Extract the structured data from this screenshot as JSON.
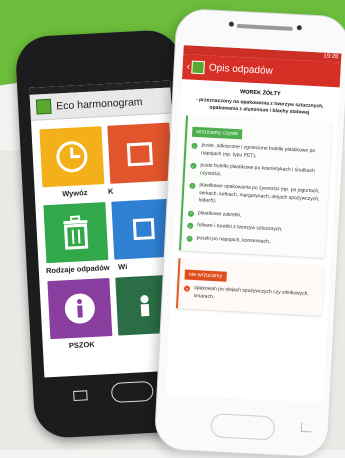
{
  "back_app": {
    "title": "Eco harmonogram",
    "tiles": [
      {
        "label": "Wywóz",
        "color": "#f4b01a",
        "icon": "clock-icon"
      },
      {
        "label": "Rodzaje odpadów",
        "color": "#31a84a",
        "icon": "trash-icon"
      },
      {
        "label": "PSZOK",
        "color": "#8a3fa0",
        "icon": "info-icon"
      },
      {
        "label": "K",
        "color": "#e0552b",
        "icon": "calendar-icon"
      },
      {
        "label": "Wi",
        "color": "#2f7fd2",
        "icon": "map-icon"
      },
      {
        "label": "",
        "color": "#2b6e45",
        "icon": "people-icon"
      }
    ]
  },
  "front_app": {
    "status_time": "19:28",
    "title": "Opis odpadów",
    "heading": "WOREK ŻÓŁTY",
    "subtitle": "- przeznaczony na opakowania z tworzyw sztucznych, opakowania z aluminium i blachy stalowej",
    "accepted": {
      "label": "wrzucamy czyste",
      "items": [
        "puste, odkręcone i zgniecione butelki plastikowe po napojach (np. typu PET),",
        "puste butelki plastikowe po kosmetykach i środkach czystości,",
        "plastikowe opakowania po żywności (np. po jogurtach, serkach, kefirach, margarynach, olejach spożywczych, lodach),",
        "plastikowe zakrętki,",
        "foliowe i torebki z tworzyw sztucznych,",
        "puszki po napojach, konserwach,"
      ]
    },
    "rejected": {
      "label": "nie wrzucamy",
      "items": [
        "opakowań po olejach spożywczych czy silnikowych, smarach,"
      ]
    }
  }
}
